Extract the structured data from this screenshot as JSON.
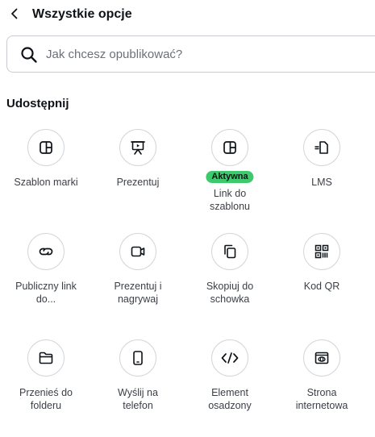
{
  "header": {
    "back_label": "<",
    "title": "Wszystkie opcje"
  },
  "search": {
    "placeholder": "Jak chcesz opublikować?",
    "value": ""
  },
  "section": {
    "title": "Udostępnij"
  },
  "options": [
    {
      "label": "Szablon marki",
      "icon": "brand-template-icon"
    },
    {
      "label": "Prezentuj",
      "icon": "present-icon"
    },
    {
      "label": "Link do\nszablonu",
      "icon": "template-link-icon",
      "badge": "Aktywna"
    },
    {
      "label": "LMS",
      "icon": "lms-icon"
    },
    {
      "label": "Publiczny link\ndo...",
      "icon": "link-icon"
    },
    {
      "label": "Prezentuj i\nnagrywaj",
      "icon": "record-icon"
    },
    {
      "label": "Skopiuj do\nschowka",
      "icon": "copy-icon"
    },
    {
      "label": "Kod QR",
      "icon": "qr-code-icon"
    },
    {
      "label": "Przenieś do\nfolderu",
      "icon": "folder-icon"
    },
    {
      "label": "Wyślij na\ntelefon",
      "icon": "phone-icon"
    },
    {
      "label": "Element\nosadzony",
      "icon": "embed-icon"
    },
    {
      "label": "Strona\ninternetowa",
      "icon": "website-icon"
    }
  ],
  "colors": {
    "badge": "#3ec96d",
    "text": "#0e1318",
    "muted": "#6b7079",
    "border": "#d3d6da"
  }
}
